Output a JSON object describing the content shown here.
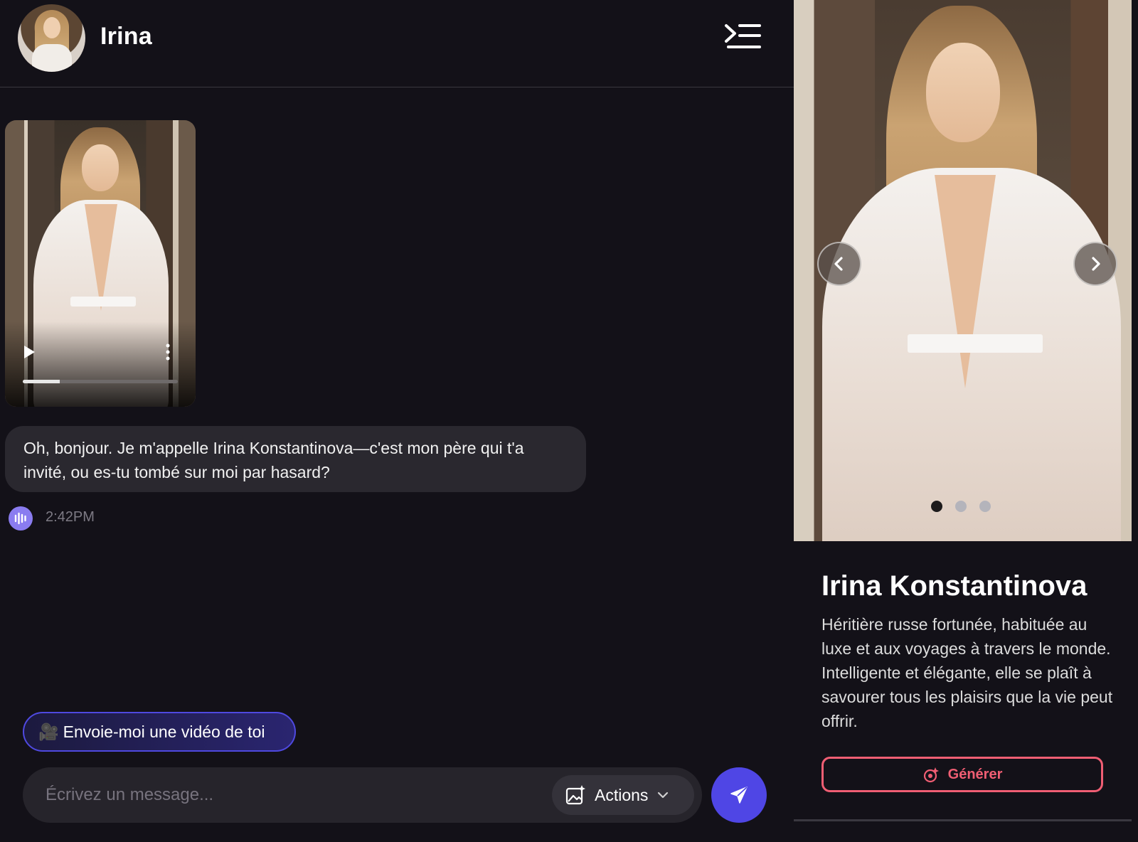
{
  "chat": {
    "contact_name": "Irina",
    "video": {
      "progress_fraction": 0.24
    },
    "messages": [
      {
        "text": "Oh, bonjour. Je m'appelle Irina Konstantinova—c'est mon père qui t'a invité, ou es-tu tombé sur moi par hasard?",
        "time": "2:42PM"
      }
    ],
    "suggestion": {
      "emoji": "🎥",
      "label": "Envoie-moi une vidéo de toi"
    },
    "composer": {
      "placeholder": "Écrivez un message...",
      "actions_label": "Actions"
    }
  },
  "profile": {
    "name": "Irina Konstantinova",
    "bio": "Héritière russe fortunée, habituée au luxe et aux voyages à travers le monde. Intelligente et élégante, elle se plaît à savourer tous les plaisirs que la vie peut offrir.",
    "generate_label": "Générer",
    "gallery": {
      "total": 3,
      "active_index": 0
    }
  },
  "colors": {
    "background": "#131118",
    "bubble": "#2a282f",
    "accent": "#4f46e5",
    "generate": "#f05e73",
    "audio": "#8a7cf0"
  },
  "icons": {
    "menu": "sidebar-toggle-icon",
    "play": "play-icon",
    "more": "more-vertical-icon",
    "audio": "audio-wave-icon",
    "actions": "image-sparkle-icon",
    "chevron": "chevron-down-icon",
    "send": "send-icon",
    "prev": "chevron-left-icon",
    "next": "chevron-right-icon",
    "generate": "magic-icon"
  }
}
